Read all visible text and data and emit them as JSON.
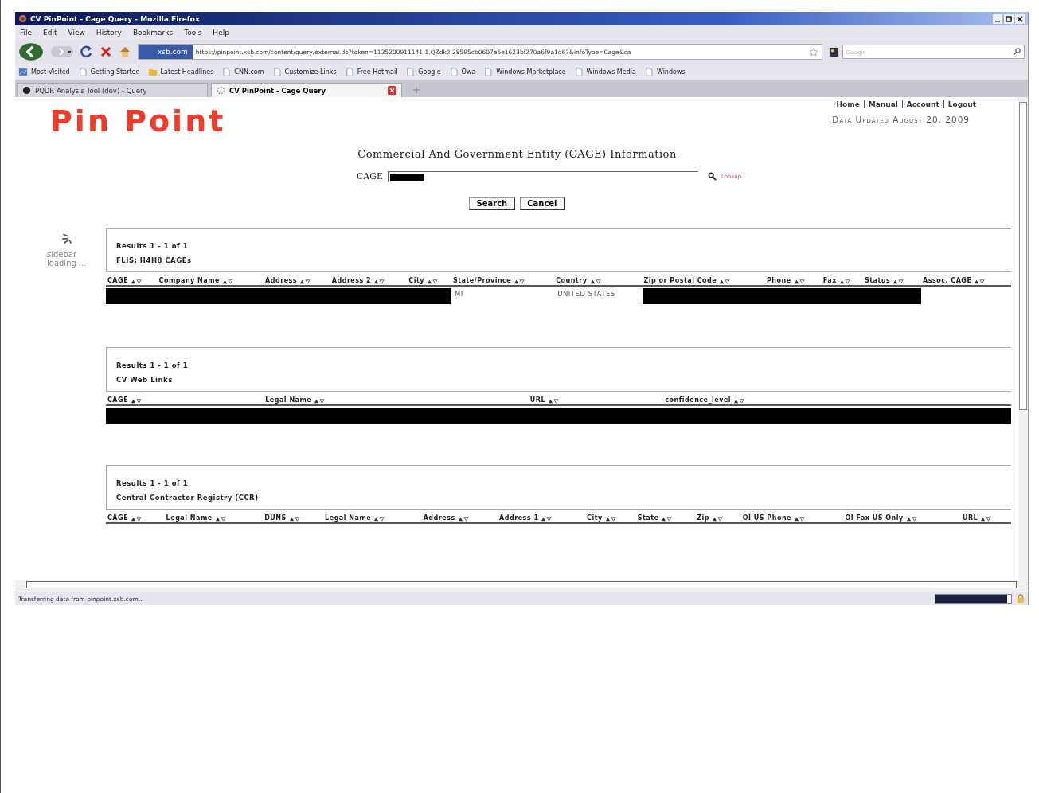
{
  "window": {
    "title": "CV PinPoint - Cage Query - Mozilla Firefox"
  },
  "menu": [
    "File",
    "Edit",
    "View",
    "History",
    "Bookmarks",
    "Tools",
    "Help"
  ],
  "navbar": {
    "site": "xsb.com",
    "url": "https://pinpoint.xsb.com/content/query/external.do?token=1125200911141 1.QZdk2.28595cb0607e6e1623bf270a6f9a1d67&infoType=Cage&ca",
    "search_placeholder": "Google"
  },
  "bookmarks": [
    {
      "label": "Most Visited",
      "kind": "special"
    },
    {
      "label": "Getting Started",
      "kind": "page"
    },
    {
      "label": "Latest Headlines",
      "kind": "feed"
    },
    {
      "label": "CNN.com",
      "kind": "page"
    },
    {
      "label": "Customize Links",
      "kind": "page"
    },
    {
      "label": "Free Hotmail",
      "kind": "page"
    },
    {
      "label": "Google",
      "kind": "page"
    },
    {
      "label": "Owa",
      "kind": "page"
    },
    {
      "label": "Windows Marketplace",
      "kind": "page"
    },
    {
      "label": "Windows Media",
      "kind": "page"
    },
    {
      "label": "Windows",
      "kind": "page"
    }
  ],
  "tabs": [
    {
      "label": "PQDR Analysis Tool (dev) - Query",
      "selected": false
    },
    {
      "label": "CV PinPoint - Cage Query",
      "selected": true
    }
  ],
  "page": {
    "logo": "Pin Point",
    "links": [
      "Home",
      "Manual",
      "Account",
      "Logout"
    ],
    "updated": "Data Updated August 20, 2009",
    "heading": "Commercial And Government Entity (CAGE) Information",
    "field_label": "CAGE",
    "lookup": "Lookup",
    "buttons": [
      "Search",
      "Cancel"
    ],
    "sidebar": "sidebar loading ..."
  },
  "panels": [
    {
      "results": "Results 1 - 1 of 1",
      "title": "FLIS: H4H8 CAGEs",
      "columns": [
        "CAGE",
        "Company Name",
        "Address",
        "Address 2",
        "City",
        "State/Province",
        "Country",
        "Zip or Postal Code",
        "Phone",
        "Fax",
        "Status",
        "Assoc. CAGE"
      ],
      "rows": [
        [
          {
            "redacted": true
          },
          {
            "redacted": true
          },
          {
            "redacted": true
          },
          {
            "redacted": true
          },
          {
            "redacted": true
          },
          {
            "redacted": false,
            "text": "MI"
          },
          {
            "redacted": false,
            "text": "UNITED STATES"
          },
          {
            "redacted": true
          },
          {
            "redacted": true
          },
          {
            "redacted": true
          },
          {
            "redacted": true
          },
          {
            "redacted": false
          }
        ]
      ]
    },
    {
      "results": "Results 1 - 1 of 1",
      "title": "CV Web Links",
      "columns": [
        "CAGE",
        "Legal Name",
        "URL",
        "confidence_level"
      ],
      "rows": [
        [
          {
            "redacted": true
          },
          {
            "redacted": true
          },
          {
            "redacted": true
          },
          {
            "redacted": true
          }
        ]
      ]
    },
    {
      "results": "Results 1 - 1 of 1",
      "title": "Central Contractor Registry (CCR)",
      "columns": [
        "CAGE",
        "Legal Name",
        "DUNS",
        "Legal Name",
        "Address",
        "Address 1",
        "City",
        "State",
        "Zip",
        "OI US Phone",
        "OI Fax US Only",
        "URL"
      ]
    }
  ],
  "status_bar": {
    "text": "Transferring data from pinpoint.xsb.com...",
    "level": 0.95
  }
}
